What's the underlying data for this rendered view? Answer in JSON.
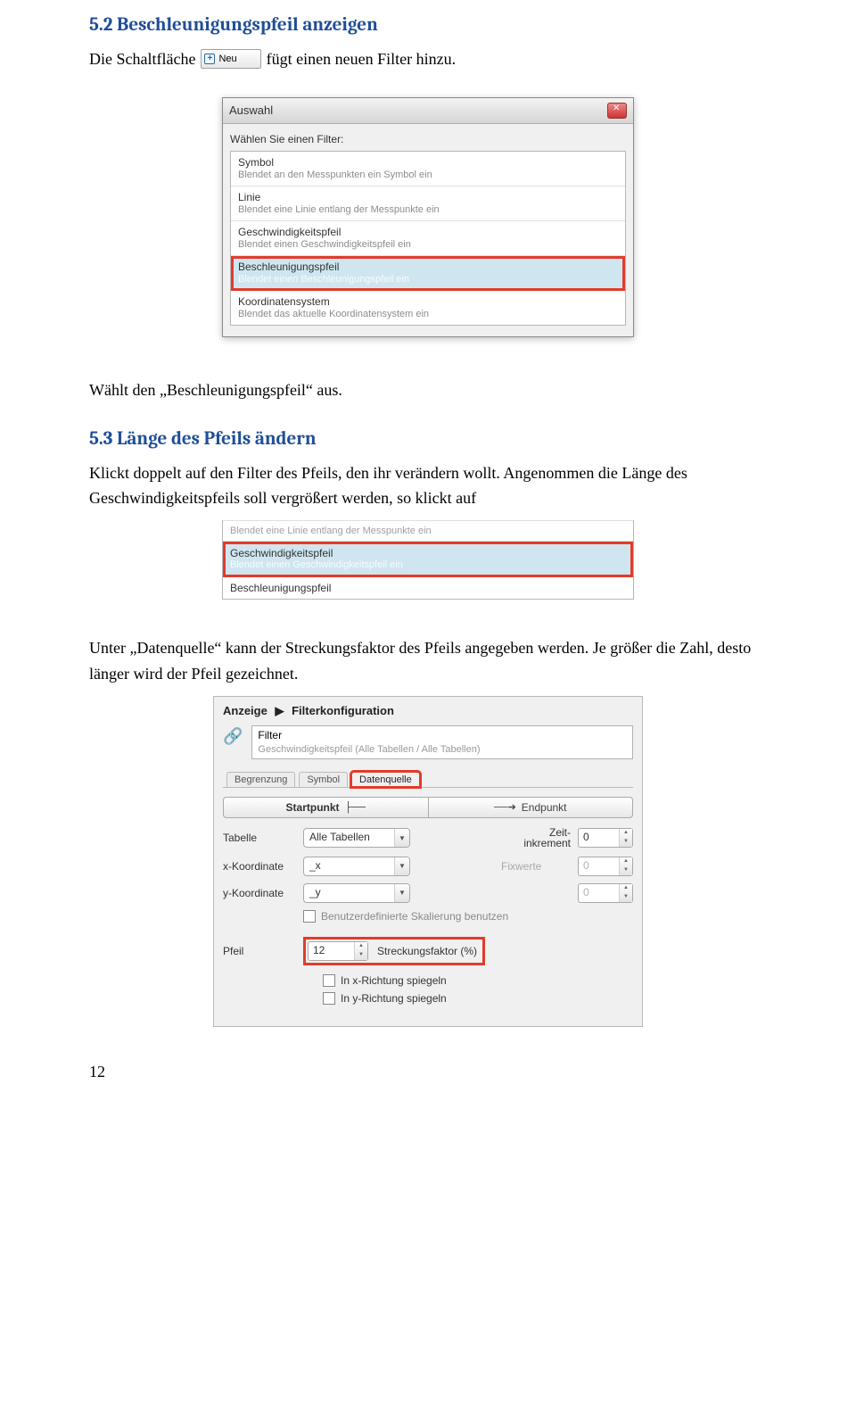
{
  "sections": {
    "s52_title": "5.2 Beschleunigungspfeil anzeigen",
    "s52_para_pre": "Die Schaltfläche",
    "s52_para_post": "fügt einen neuen Filter hinzu.",
    "neu_label": "Neu",
    "waehlt": "Wählt den „Beschleunigungspfeil“ aus.",
    "s53_title": "5.3 Länge des Pfeils ändern",
    "s53_para": "Klickt doppelt auf den Filter des Pfeils, den ihr verändern wollt. Angenommen die Länge des Geschwindigkeitspfeils soll vergrößert werden, so klickt auf",
    "unter_para": "Unter „Datenquelle“ kann der Streckungsfaktor des Pfeils angegeben werden. Je größer die Zahl, desto länger wird der Pfeil gezeichnet.",
    "page_number": "12"
  },
  "auswahl_dialog": {
    "title": "Auswahl",
    "prompt": "Wählen Sie einen Filter:",
    "items": [
      {
        "title": "Symbol",
        "desc": "Blendet an den Messpunkten ein Symbol ein"
      },
      {
        "title": "Linie",
        "desc": "Blendet eine Linie entlang der Messpunkte ein"
      },
      {
        "title": "Geschwindigkeitspfeil",
        "desc": "Blendet einen Geschwindigkeitspfeil ein"
      },
      {
        "title": "Beschleunigungspfeil",
        "desc": "Blendet einen Beschleunigungspfeil ein"
      },
      {
        "title": "Koordinatensystem",
        "desc": "Blendet das aktuelle Koordinatensystem ein"
      }
    ]
  },
  "snippet": {
    "top_desc": "Blendet eine Linie entlang der Messpunkte ein",
    "sel_title": "Geschwindigkeitspfeil",
    "sel_desc": "Blendet einen Geschwindigkeitspfeil ein",
    "bottom_title": "Beschleunigungspfeil"
  },
  "fk": {
    "crumb1": "Anzeige",
    "crumb2": "Filterkonfiguration",
    "filter_value": "Filter",
    "filter_sub": "Geschwindigkeitspfeil (Alle Tabellen / Alle Tabellen)",
    "tabs": {
      "t1": "Begrenzung",
      "t2": "Symbol",
      "t3": "Datenquelle"
    },
    "seg": {
      "start": "Startpunkt",
      "end": "Endpunkt"
    },
    "labels": {
      "tabelle": "Tabelle",
      "zeit": "Zeit-\ninkrement",
      "x": "x-Koordinate",
      "fix": "Fixwerte",
      "y": "y-Koordinate",
      "benutz": "Benutzerdefinierte Skalierung benutzen",
      "pfeil": "Pfeil",
      "streck": "Streckungsfaktor (%)",
      "mirx": "In x-Richtung spiegeln",
      "miry": "In y-Richtung spiegeln"
    },
    "values": {
      "tabelle": "Alle Tabellen",
      "zeit": "0",
      "x": "_x",
      "fixx": "0",
      "y": "_y",
      "fixy": "0",
      "pfeil": "12"
    }
  }
}
